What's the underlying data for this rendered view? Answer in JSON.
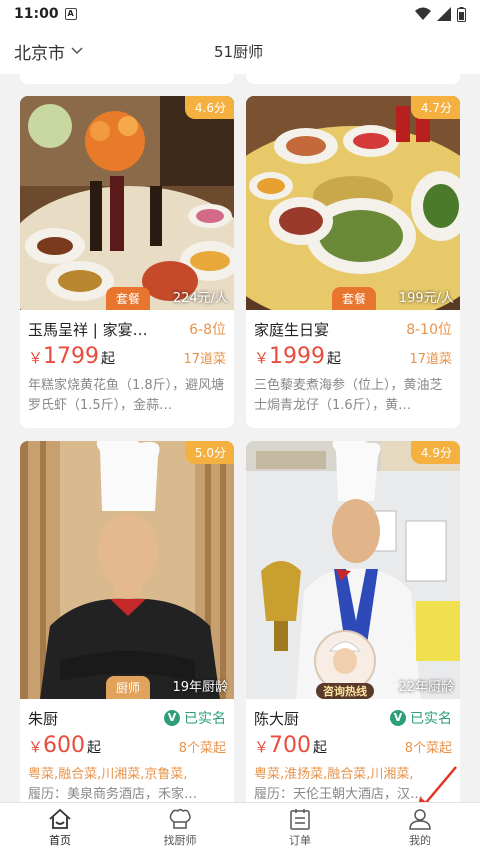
{
  "status": {
    "time": "11:00",
    "badge": "A"
  },
  "header": {
    "city": "北京市",
    "chef_count": "51厨师"
  },
  "cards": [
    {
      "rating": "4.6分",
      "tag": "套餐",
      "price_per": "224元/人",
      "name": "玉馬呈祥 | 家宴…",
      "persons": "6-8位",
      "price": "1799",
      "price_suffix": "起",
      "dishes": "17道菜",
      "desc": "年糕家烧黄花鱼（1.8斤），避风塘罗氏虾（1.5斤），金蒜…"
    },
    {
      "rating": "4.7分",
      "tag": "套餐",
      "price_per": "199元/人",
      "name": "家庭生日宴",
      "persons": "8-10位",
      "price": "1999",
      "price_suffix": "起",
      "dishes": "17道菜",
      "desc": "三色藜麦煮海参（位上），黄油芝士焗青龙仔（1.6斤），黄…"
    },
    {
      "rating": "5.0分",
      "tag": "厨师",
      "years": "19年厨龄",
      "name": "朱厨",
      "verified": "已实名",
      "price": "600",
      "price_suffix": "起",
      "dishes": "8个菜起",
      "cuisine": "粤菜,融合菜,川湘菜,京鲁菜,",
      "hotel": "履历：美泉商务酒店，禾家…"
    },
    {
      "rating": "4.9分",
      "years": "22年厨龄",
      "consult": "咨询热线",
      "name": "陈大厨",
      "verified": "已实名",
      "price": "700",
      "price_suffix": "起",
      "dishes": "8个菜起",
      "cuisine": "粤菜,淮扬菜,融合菜,川湘菜,",
      "hotel": "履历：天伦王朝大酒店，汉…"
    }
  ],
  "currency": "￥",
  "tabs": [
    {
      "label": "首页",
      "icon": "home-icon"
    },
    {
      "label": "找厨师",
      "icon": "chef-hat-icon"
    },
    {
      "label": "订单",
      "icon": "order-icon"
    },
    {
      "label": "我的",
      "icon": "user-icon"
    }
  ],
  "colors": {
    "accent": "#e84c3d",
    "orange": "#e8934a",
    "rating": "#f5b13f",
    "verified": "#2e9e7a"
  }
}
